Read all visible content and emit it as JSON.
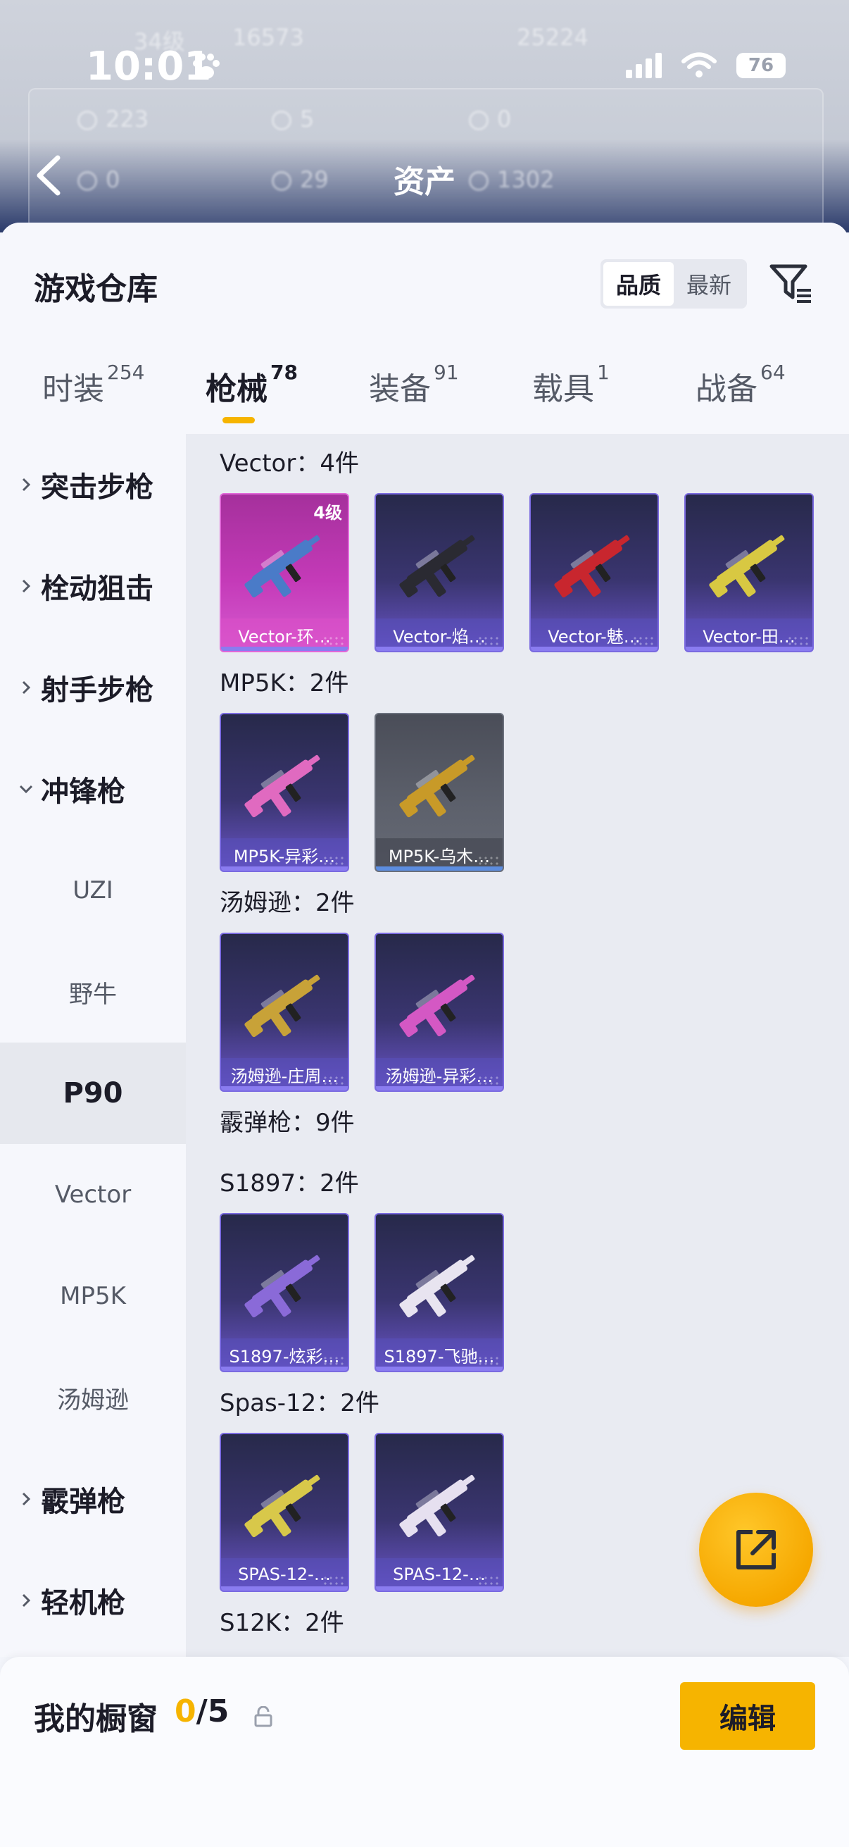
{
  "status_bar": {
    "time": "10:01",
    "battery": "76"
  },
  "header": {
    "title": "资产"
  },
  "ghost_stats": [
    "34级",
    "16573",
    "25224",
    "223",
    "5",
    "0",
    "0",
    "29",
    "1302"
  ],
  "sheet": {
    "title": "游戏仓库",
    "sort_options": [
      "品质",
      "最新"
    ],
    "sort_selected": "品质"
  },
  "tabs": [
    {
      "label": "时装",
      "count": "254"
    },
    {
      "label": "枪械",
      "count": "78"
    },
    {
      "label": "装备",
      "count": "91"
    },
    {
      "label": "载具",
      "count": "1"
    },
    {
      "label": "战备",
      "count": "64"
    }
  ],
  "active_tab": "枪械",
  "sidebar": {
    "categories": [
      "突击步枪",
      "栓动狙击",
      "射手步枪",
      "冲锋枪"
    ],
    "subs": [
      "UZI",
      "野牛",
      "P90",
      "Vector",
      "MP5K",
      "汤姆逊"
    ],
    "active_sub": "P90",
    "more": [
      "霰弹枪",
      "轻机枪"
    ]
  },
  "sections": [
    {
      "title": "Vector：4件",
      "items": [
        {
          "label": "Vector-环…",
          "level": "4级",
          "style": "pink",
          "color": "#4a7bc8"
        },
        {
          "label": "Vector-焰…",
          "style": "purple",
          "color": "#2a2a32"
        },
        {
          "label": "Vector-魅…",
          "style": "purple",
          "color": "#c8262e"
        },
        {
          "label": "Vector-田…",
          "style": "purple",
          "color": "#d8c842"
        }
      ]
    },
    {
      "title": "MP5K：2件",
      "items": [
        {
          "label": "MP5K-异彩…",
          "style": "purple",
          "color": "#e06ac0"
        },
        {
          "label": "MP5K-乌木…",
          "style": "gray",
          "color": "#c89a28"
        }
      ]
    },
    {
      "title": "汤姆逊：2件",
      "items": [
        {
          "label": "汤姆逊-庄周…",
          "style": "purple",
          "color": "#c8a238"
        },
        {
          "label": "汤姆逊-异彩…",
          "style": "purple",
          "color": "#d458c4"
        }
      ]
    },
    {
      "title": "霰弹枪：9件",
      "items": []
    },
    {
      "title": "S1897：2件",
      "items": [
        {
          "label": "S1897-炫彩…",
          "style": "purple",
          "color": "#8a6ad8"
        },
        {
          "label": "S1897-飞驰…",
          "style": "purple",
          "color": "#e8e4f0"
        }
      ]
    },
    {
      "title": "Spas-12：2件",
      "items": [
        {
          "label": "SPAS-12-…",
          "style": "purple",
          "color": "#d8c84a"
        },
        {
          "label": "SPAS-12-…",
          "style": "purple",
          "color": "#e6e0f0"
        }
      ]
    },
    {
      "title": "S12K：2件",
      "items": []
    }
  ],
  "bottom": {
    "title": "我的橱窗",
    "current": "0",
    "total": "/5",
    "edit_label": "编辑"
  },
  "colors": {
    "accent": "#f6b400",
    "card_border": "#7a6ae0"
  },
  "icons": [
    "paw-icon",
    "signal-icon",
    "wifi-icon",
    "back-arrow-icon",
    "filter-icon",
    "chevron-right-icon",
    "chevron-down-icon",
    "share-icon",
    "lock-icon",
    "gun-icon"
  ]
}
